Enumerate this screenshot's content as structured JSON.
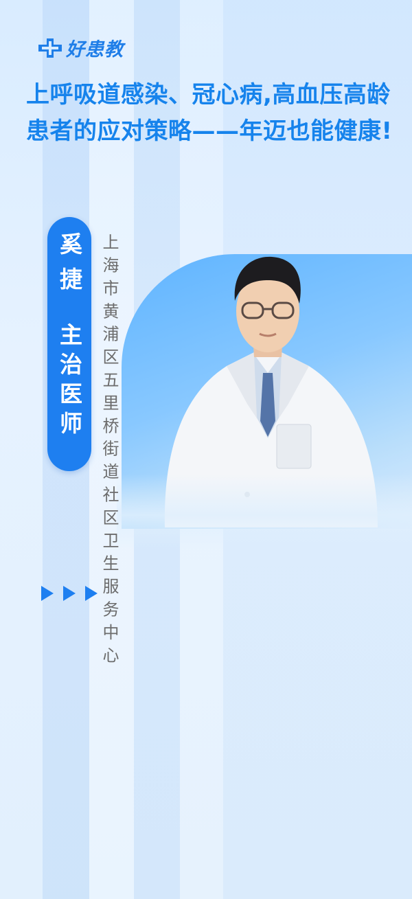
{
  "brand": {
    "logo_text": "好患教",
    "logo_icon": "medical-cross-logo-icon",
    "accent_color": "#1e7ff0"
  },
  "headline": {
    "text": "上呼吸道感染、冠心病,高血压高龄患者的应对策略——年迈也能健康!"
  },
  "doctor": {
    "name": "奚捷",
    "title": "主治医师",
    "affiliation": "上海市黄浦区五里桥街道社区卫生服务中心",
    "photo": "doctor-portrait"
  },
  "decor": {
    "arrow_icon": "triangle-right-icon",
    "arrow_count": 3
  }
}
